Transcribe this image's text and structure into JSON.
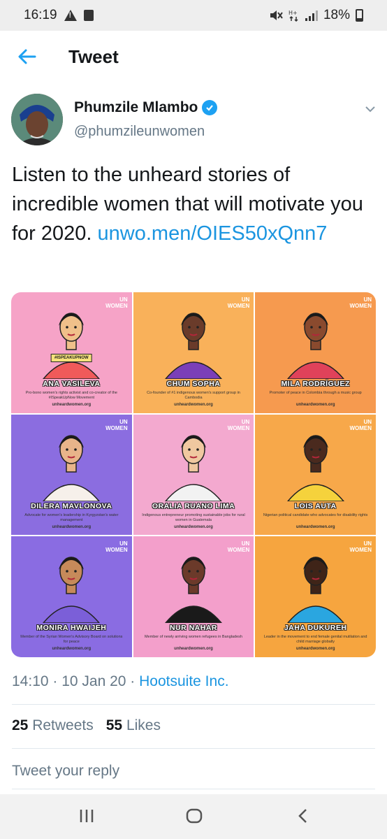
{
  "status_bar": {
    "time": "16:19",
    "battery": "18%"
  },
  "header": {
    "title": "Tweet"
  },
  "author": {
    "name": "Phumzile Mlambo",
    "handle": "@phumzileunwomen"
  },
  "tweet": {
    "text": "Listen to the unheard stories of incredible women that will motivate you for 2020. ",
    "link": "unwo.men/OIES50xQnn7"
  },
  "media": {
    "logo_line1": "UN",
    "logo_line2": "WOMEN",
    "site": "unheardwomen.org",
    "tiles": [
      {
        "name": "ANA VASILEVA",
        "bg": "#f6a3c7",
        "desc": "Pro-bono women's rights activist and co-creator of the #ISpeakUpNow Movement",
        "sign": "#ISPEAKUPNOW"
      },
      {
        "name": "CHUM SOPHA",
        "bg": "#f9b15a",
        "desc": "Co-founder of #1 indigenous women's support group in Cambodia"
      },
      {
        "name": "MILA RODRÍGUEZ",
        "bg": "#f69a4f",
        "desc": "Promoter of peace in Colombia through a music group"
      },
      {
        "name": "DILERA MAVLONOVA",
        "bg": "#8b6de0",
        "desc": "Advocate for women's leadership in Kyrgyzstan's water management"
      },
      {
        "name": "ORALIA RUANO LIMA",
        "bg": "#f3a9cf",
        "desc": "Indigenous entrepreneur promoting sustainable jobs for rural women in Guatemala"
      },
      {
        "name": "LOIS AUTA",
        "bg": "#f7a84a",
        "desc": "Nigerian political candidate who advocates for disability rights"
      },
      {
        "name": "MONIRA HWAIJEH",
        "bg": "#8a6ce2",
        "desc": "Member of the Syrian Women's Advisory Board on solutions for peace"
      },
      {
        "name": "NUR NAHAR",
        "bg": "#f39fcb",
        "desc": "Member of newly arriving women refugees in Bangladesh"
      },
      {
        "name": "JAHA DUKUREH",
        "bg": "#f6a53f",
        "desc": "Leader in the movement to end female genital mutilation and child marriage globally"
      }
    ]
  },
  "meta": {
    "time": "14:10 · 10 Jan 20 · ",
    "source": "Hootsuite Inc."
  },
  "stats": {
    "retweets_count": "25",
    "retweets_label": "Retweets",
    "likes_count": "55",
    "likes_label": "Likes"
  },
  "reply": {
    "placeholder": "Tweet your reply"
  },
  "colors": {
    "accent": "#1da1f2",
    "link": "#1b95e0",
    "muted": "#657786"
  }
}
